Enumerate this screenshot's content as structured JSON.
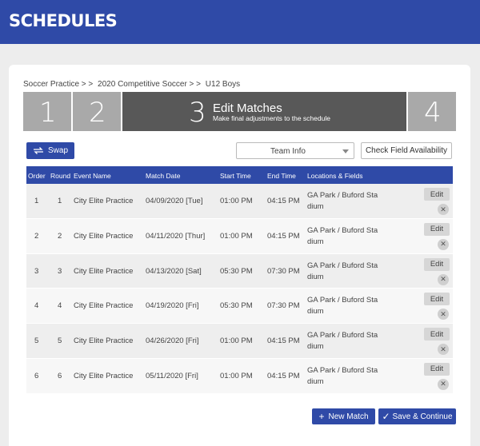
{
  "header": {
    "title": "SCHEDULES"
  },
  "breadcrumb": [
    "Soccer Practice > >",
    "2020 Competitive Soccer > >",
    "U12 Boys"
  ],
  "steps": [
    {
      "num": "1"
    },
    {
      "num": "2"
    },
    {
      "num": "3",
      "title": "Edit Matches",
      "subtitle": "Make final adjustments to the schedule"
    },
    {
      "num": "4"
    }
  ],
  "toolbar": {
    "swap_label": "Swap",
    "team_select_value": "Team Info",
    "availability_label": "Check Field Availability"
  },
  "table": {
    "headers": {
      "order": "Order",
      "round": "Round",
      "event": "Event Name",
      "date": "Match Date",
      "start": "Start Time",
      "end": "End Time",
      "location": "Locations & Fields"
    },
    "edit_label": "Edit",
    "delete_glyph": "✕",
    "rows": [
      {
        "order": "1",
        "round": "1",
        "event": "City Elite Practice",
        "date": "04/09/2020 [Tue]",
        "start": "01:00 PM",
        "end": "04:15 PM",
        "location": "GA Park / Buford Sta dium"
      },
      {
        "order": "2",
        "round": "2",
        "event": "City Elite Practice",
        "date": "04/11/2020 [Thur]",
        "start": "01:00 PM",
        "end": "04:15 PM",
        "location": "GA Park / Buford Sta dium"
      },
      {
        "order": "3",
        "round": "3",
        "event": "City Elite Practice",
        "date": "04/13/2020 [Sat]",
        "start": "05:30 PM",
        "end": "07:30 PM",
        "location": "GA Park / Buford Sta dium"
      },
      {
        "order": "4",
        "round": "4",
        "event": "City Elite Practice",
        "date": "04/19/2020 [Fri]",
        "start": "05:30 PM",
        "end": "07:30 PM",
        "location": "GA Park / Buford Sta dium"
      },
      {
        "order": "5",
        "round": "5",
        "event": "City Elite Practice",
        "date": "04/26/2020 [Fri]",
        "start": "01:00 PM",
        "end": "04:15 PM",
        "location": "GA Park / Buford Sta dium"
      },
      {
        "order": "6",
        "round": "6",
        "event": "City Elite Practice",
        "date": "05/11/2020 [Fri]",
        "start": "01:00 PM",
        "end": "04:15 PM",
        "location": "GA Park / Buford Sta dium"
      }
    ]
  },
  "footer": {
    "new_match_label": "New Match",
    "new_match_glyph": "+",
    "save_label": "Save & Continue",
    "save_glyph": "✓"
  },
  "colors": {
    "primary": "#2f4aa7",
    "step_inactive": "#a9a9a9",
    "step_active": "#585858"
  }
}
